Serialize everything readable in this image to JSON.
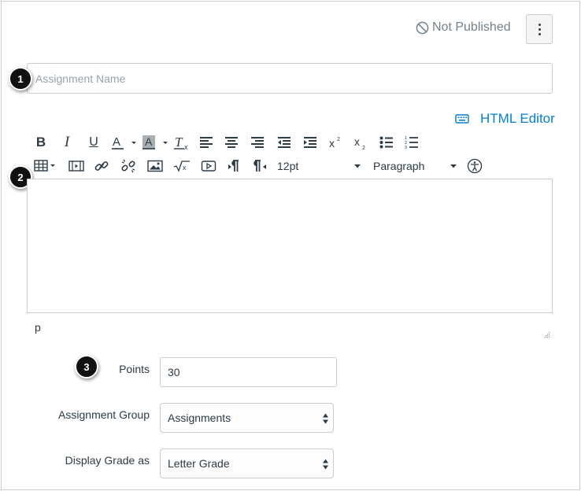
{
  "header": {
    "status_text": "Not Published",
    "status_icon": "unpublished-circle-icon",
    "menu_icon": "kebab-menu-icon"
  },
  "assignment_name": {
    "placeholder": "Assignment Name",
    "value": ""
  },
  "callouts": [
    "1",
    "2",
    "3"
  ],
  "editor": {
    "html_editor_label": "HTML Editor",
    "html_editor_icon": "keyboard-icon",
    "font_size": "12pt",
    "block_format": "Paragraph",
    "path": "p",
    "toolbar_row1_icons": [
      "bold-icon",
      "italic-icon",
      "underline-icon",
      "text-color-icon",
      "background-color-icon",
      "clear-formatting-icon",
      "align-left-icon",
      "align-center-icon",
      "align-right-icon",
      "outdent-icon",
      "indent-icon",
      "superscript-icon",
      "subscript-icon",
      "bullet-list-icon",
      "numbered-list-icon"
    ],
    "toolbar_row2_icons": [
      "table-icon",
      "media-icon",
      "link-icon",
      "unlink-icon",
      "image-icon",
      "equation-icon",
      "embed-icon",
      "ltr-icon",
      "rtl-icon",
      "accessibility-icon"
    ]
  },
  "fields": {
    "points_label": "Points",
    "points_value": "30",
    "group_label": "Assignment Group",
    "group_value": "Assignments",
    "grade_label": "Display Grade as",
    "grade_value": "Letter Grade"
  },
  "colors": {
    "link": "#0081d0",
    "border": "#c7cdd1",
    "text": "#2d3b45",
    "muted": "#73818c",
    "callout": "#111111"
  }
}
